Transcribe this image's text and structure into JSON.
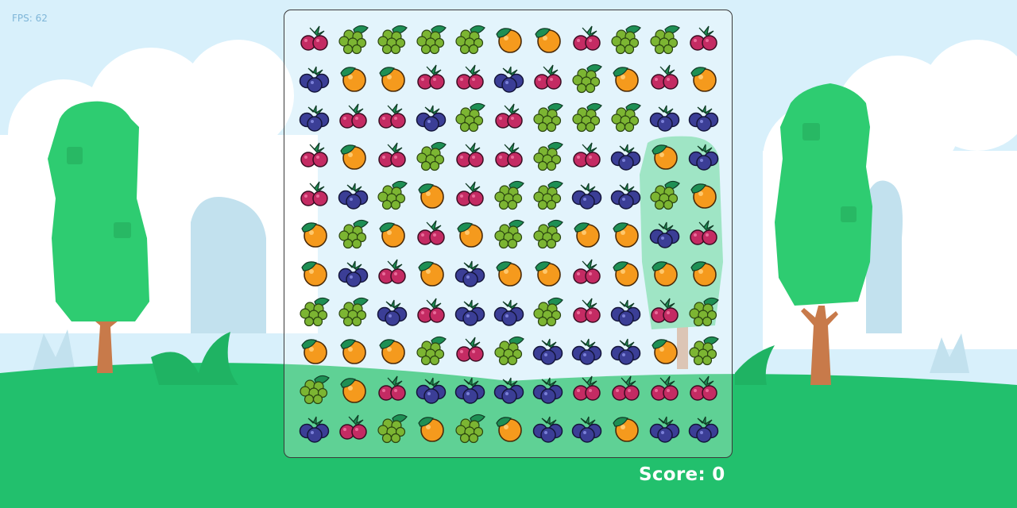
{
  "hud": {
    "fps_label": "FPS: 62",
    "score_label": "Score: 0"
  },
  "colors": {
    "sky": "#d8f0fb",
    "cloud": "#ffffff",
    "bg_hill": "#c2e1ee",
    "grass": "#22c06d",
    "tree_foliage": "#2ecc71",
    "trunk": "#c87a4a",
    "berry": "#c42b63",
    "orange": "#f59a1d",
    "blueberry": "#3b3e96",
    "grape": "#7cb532",
    "leaf": "#1e8f54"
  },
  "board": {
    "rows": 11,
    "cols": 11,
    "fruit_types": [
      "raspberry",
      "grapes",
      "orange",
      "blueberry"
    ],
    "tiles": [
      [
        "raspberry",
        "grapes",
        "grapes",
        "grapes",
        "grapes",
        "orange",
        "orange",
        "raspberry",
        "grapes",
        "grapes",
        "raspberry"
      ],
      [
        "blueberry",
        "orange",
        "orange",
        "raspberry",
        "raspberry",
        "blueberry",
        "raspberry",
        "grapes",
        "orange",
        "raspberry",
        "orange"
      ],
      [
        "blueberry",
        "raspberry",
        "raspberry",
        "blueberry",
        "grapes",
        "raspberry",
        "grapes",
        "grapes",
        "grapes",
        "blueberry",
        "blueberry"
      ],
      [
        "raspberry",
        "orange",
        "raspberry",
        "grapes",
        "raspberry",
        "raspberry",
        "grapes",
        "raspberry",
        "blueberry",
        "orange",
        "blueberry"
      ],
      [
        "raspberry",
        "blueberry",
        "grapes",
        "orange",
        "raspberry",
        "grapes",
        "grapes",
        "blueberry",
        "blueberry",
        "grapes",
        "orange"
      ],
      [
        "orange",
        "grapes",
        "orange",
        "raspberry",
        "orange",
        "grapes",
        "grapes",
        "orange",
        "orange",
        "blueberry",
        "raspberry"
      ],
      [
        "orange",
        "blueberry",
        "raspberry",
        "orange",
        "blueberry",
        "orange",
        "orange",
        "raspberry",
        "orange",
        "orange",
        "orange"
      ],
      [
        "grapes",
        "grapes",
        "blueberry",
        "raspberry",
        "blueberry",
        "blueberry",
        "grapes",
        "raspberry",
        "blueberry",
        "raspberry",
        "grapes"
      ],
      [
        "orange",
        "orange",
        "orange",
        "grapes",
        "raspberry",
        "grapes",
        "blueberry",
        "blueberry",
        "blueberry",
        "orange",
        "grapes"
      ],
      [
        "grapes",
        "orange",
        "raspberry",
        "blueberry",
        "blueberry",
        "blueberry",
        "blueberry",
        "raspberry",
        "raspberry",
        "raspberry",
        "raspberry"
      ],
      [
        "blueberry",
        "raspberry",
        "grapes",
        "orange",
        "grapes",
        "orange",
        "blueberry",
        "blueberry",
        "orange",
        "blueberry",
        "blueberry"
      ]
    ]
  }
}
